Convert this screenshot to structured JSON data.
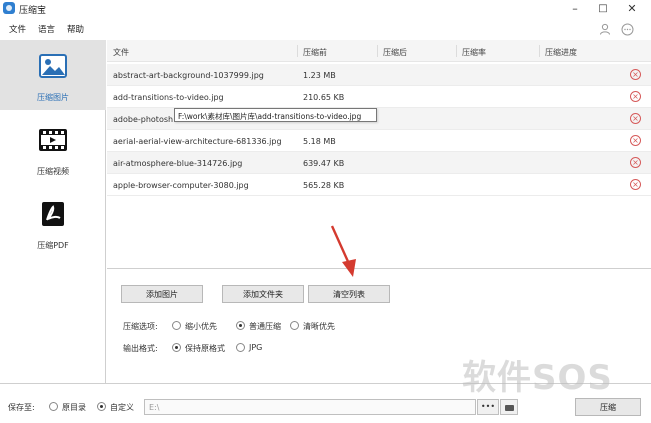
{
  "window": {
    "title": "压缩宝",
    "minimize": "–",
    "maximize": "□",
    "close": "✕"
  },
  "menu": {
    "items": [
      "文件",
      "语言",
      "帮助"
    ]
  },
  "sidebar": {
    "items": [
      {
        "label": "压缩图片",
        "active": true
      },
      {
        "label": "压缩视频",
        "active": false
      },
      {
        "label": "压缩PDF",
        "active": false
      }
    ]
  },
  "table": {
    "headers": [
      "文件",
      "压缩前",
      "压缩后",
      "压缩率",
      "压缩进度"
    ],
    "rows": [
      {
        "name": "abstract-art-background-1037999.jpg",
        "size": "1.23 MB"
      },
      {
        "name": "add-transitions-to-video.jpg",
        "size": "210.65 KB"
      },
      {
        "name": "adobe-photosh",
        "size": ""
      },
      {
        "name": "aerial-aerial-view-architecture-681336.jpg",
        "size": "5.18 MB"
      },
      {
        "name": "air-atmosphere-blue-314726.jpg",
        "size": "639.47 KB"
      },
      {
        "name": "apple-browser-computer-3080.jpg",
        "size": "565.28 KB"
      }
    ],
    "tooltip": "F:\\work\\素材库\\图片库\\add-transitions-to-video.jpg"
  },
  "actions": {
    "add_image": "添加图片",
    "add_folder": "添加文件夹",
    "clear_list": "清空列表"
  },
  "compress_options": {
    "label": "压缩选项:",
    "options": [
      "缩小优先",
      "普通压缩",
      "清晰优先"
    ],
    "selected": 1
  },
  "output_format": {
    "label": "输出格式:",
    "options": [
      "保持原格式",
      "JPG"
    ],
    "selected": 0
  },
  "save": {
    "label": "保存至:",
    "options": [
      "原目录",
      "自定义"
    ],
    "selected": 1,
    "path": "E:\\",
    "browse": "•••",
    "compress_button": "压缩"
  },
  "watermark": "软件SOS",
  "colors": {
    "accent": "#2a6fb5",
    "delete": "#d65a5a",
    "arrow": "#d43a2f"
  }
}
